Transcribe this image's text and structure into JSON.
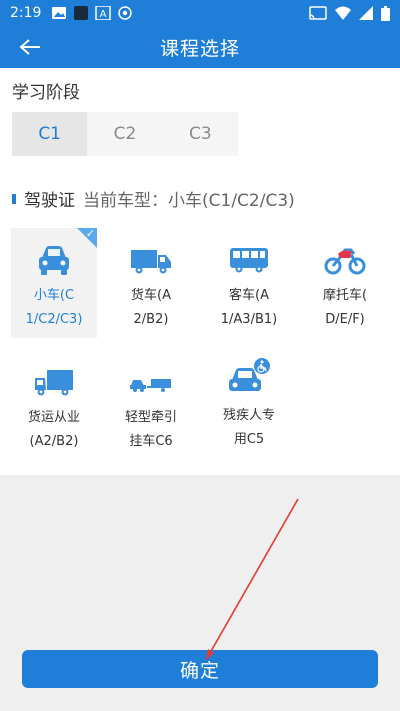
{
  "status_bar": {
    "time": "2:19",
    "left_icons": [
      "image-icon",
      "square-icon",
      "a-box-icon",
      "shield-icon"
    ],
    "right_icons": [
      "cast-icon",
      "wifi-icon",
      "signal-icon",
      "battery-icon"
    ]
  },
  "app_bar": {
    "title": "课程选择",
    "back_icon": "arrow-left-icon"
  },
  "stage": {
    "title": "学习阶段",
    "tabs": [
      {
        "label": "C1",
        "active": true
      },
      {
        "label": "C2",
        "active": false
      },
      {
        "label": "C3",
        "active": false
      }
    ]
  },
  "license": {
    "title": "驾驶证",
    "current_label": "当前车型：小车(C1/C2/C3)"
  },
  "vehicles": [
    {
      "line1": "小车(C",
      "line2": "1/C2/C3)",
      "icon": "car-icon",
      "selected": true
    },
    {
      "line1": "货车(A",
      "line2": "2/B2)",
      "icon": "truck-icon",
      "selected": false
    },
    {
      "line1": "客车(A",
      "line2": "1/A3/B1)",
      "icon": "bus-icon",
      "selected": false
    },
    {
      "line1": "摩托车(",
      "line2": "D/E/F)",
      "icon": "motorcycle-icon",
      "selected": false
    },
    {
      "line1": "货运从业",
      "line2": "(A2/B2)",
      "icon": "cargo-truck-icon",
      "selected": false
    },
    {
      "line1": "轻型牵引",
      "line2": "挂车C6",
      "icon": "trailer-icon",
      "selected": false
    },
    {
      "line1": "残疾人专",
      "line2": "用C5",
      "icon": "accessible-car-icon",
      "selected": false
    }
  ],
  "confirm": {
    "label": "确定"
  },
  "colors": {
    "primary": "#1f7ed8",
    "icon": "#3a8fdc",
    "selected_bg": "#f2f2f2"
  }
}
